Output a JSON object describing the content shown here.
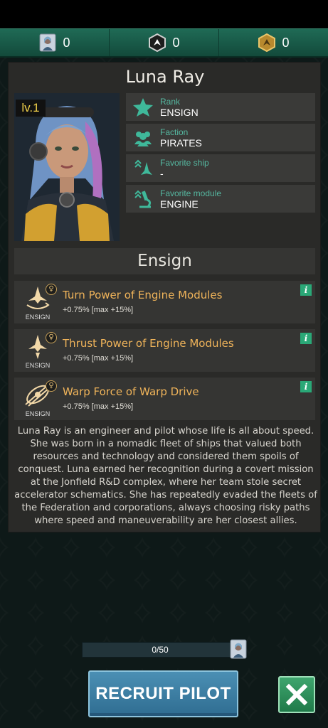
{
  "currencies": [
    {
      "icon": "pilot-portrait-icon",
      "value": "0"
    },
    {
      "icon": "ship-token-icon",
      "value": "0"
    },
    {
      "icon": "gold-token-icon",
      "value": "0"
    }
  ],
  "pilot": {
    "name": "Luna Ray",
    "level": "lv.1",
    "info": [
      {
        "icon": "star-icon",
        "label": "Rank",
        "value": "ENSIGN"
      },
      {
        "icon": "people-icon",
        "label": "Faction",
        "value": "PIRATES"
      },
      {
        "icon": "ship-icon",
        "label": "Favorite ship",
        "value": "-"
      },
      {
        "icon": "microscope-icon",
        "label": "Favorite module",
        "value": "ENGINE"
      }
    ]
  },
  "rank_title": "Ensign",
  "perks": [
    {
      "icon": "turn-engine-icon",
      "badge": "ENSIGN",
      "title": "Turn Power of Engine Modules",
      "desc": "+0.75% [max +15%]"
    },
    {
      "icon": "thrust-engine-icon",
      "badge": "ENSIGN",
      "title": "Thrust Power of Engine Modules",
      "desc": "+0.75% [max +15%]"
    },
    {
      "icon": "warp-drive-icon",
      "badge": "ENSIGN",
      "title": "Warp Force of Warp Drive",
      "desc": "+0.75% [max +15%]"
    }
  ],
  "bio": "Luna Ray is an engineer and pilot whose life is all about speed. She was born in a nomadic fleet of ships that valued both resources and technology and considered them spoils of conquest. Luna earned her recognition during a covert mission at the Jonfield R&D complex, where her team stole secret accelerator schematics. She has repeatedly evaded the fleets of the Federation and corporations, always choosing risky paths where speed and maneuverability are her closest allies.",
  "progress": {
    "text": "0/50",
    "fraction": 0.0
  },
  "buttons": {
    "recruit": "RECRUIT PILOT"
  },
  "colors": {
    "accent_green": "#55b7a0",
    "perk_title": "#f0b45a",
    "level_text": "#f2d24a"
  }
}
